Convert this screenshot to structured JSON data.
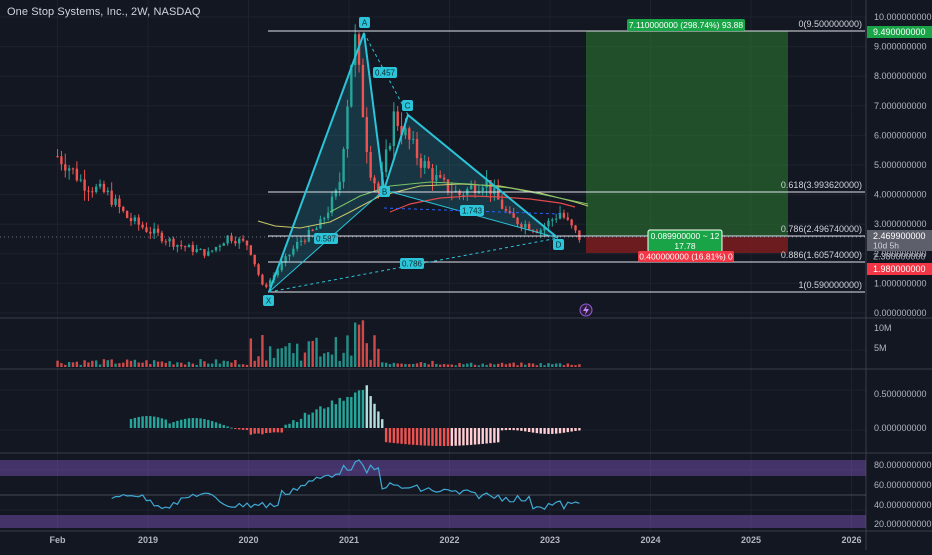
{
  "header": {
    "title": "One Stop Systems, Inc., 2W, NASDAQ"
  },
  "price_axis": {
    "ticks": [
      "10.000000000",
      "9.000000000",
      "8.000000000",
      "7.000000000",
      "6.000000000",
      "5.000000000",
      "4.000000000",
      "3.000000000",
      "2.000000000",
      "1.000000000",
      "0.000000000"
    ],
    "tag_target": "9.490000000",
    "tag_last": "2.469900000",
    "tag_countdown": "10d 5h",
    "tag_2380": "2.380000000",
    "tag_stop": "1.980000000"
  },
  "volume_axis": {
    "ticks": [
      "10M",
      "5M"
    ]
  },
  "macd_axis": {
    "ticks": [
      "0.500000000",
      "0.000000000"
    ]
  },
  "rsi_axis": {
    "ticks": [
      "80.000000000",
      "60.000000000",
      "40.000000000",
      "20.000000000"
    ]
  },
  "time_axis": {
    "labels": [
      "Feb",
      "2019",
      "2020",
      "2021",
      "2022",
      "2023",
      "2024",
      "2025",
      "2026"
    ]
  },
  "fib_levels": [
    {
      "label": "0(9.500000000)"
    },
    {
      "label": "0.618(3.993620000)"
    },
    {
      "label": "0.786(2.496740000)"
    },
    {
      "label": "0.886(1.605740000)"
    },
    {
      "label": "1(0.590000000)"
    }
  ],
  "pattern": {
    "points": [
      "X",
      "A",
      "B",
      "C",
      "D"
    ],
    "ratios": [
      "0.457",
      "1.743",
      "0.587",
      "0.786"
    ]
  },
  "position": {
    "target_label": "7.110000000 (298.74%) 93.88",
    "mid_line1": "0.089900000 ~ 12",
    "mid_line2": "17.78",
    "stop_label": "0.400000000 (16.81%) 0"
  },
  "colors": {
    "background": "#131722",
    "up": "#26a69a",
    "down": "#ef5350",
    "pattern": "#2bc4d8",
    "profit_zone": "#2e7d32",
    "loss_zone": "#8b1e1e",
    "target_tag": "#19a447",
    "stop_tag": "#f23645",
    "rsi": "#3fa9d6",
    "rsi_band": "#7e57c2"
  },
  "icons": {
    "alert": "lightning-bolt-icon"
  },
  "chart_data": {
    "type": "candlestick",
    "title": "One Stop Systems, Inc., 2W, NASDAQ",
    "y_range": [
      0,
      10
    ],
    "x_range": [
      "2018-02",
      "2026"
    ],
    "approx_closes": [
      [
        2018.1,
        5.3
      ],
      [
        2018.2,
        5.0
      ],
      [
        2018.35,
        4.4
      ],
      [
        2018.6,
        4.0
      ],
      [
        2018.8,
        3.2
      ],
      [
        2019.0,
        2.8
      ],
      [
        2019.3,
        2.3
      ],
      [
        2019.6,
        2.0
      ],
      [
        2019.8,
        2.6
      ],
      [
        2020.0,
        2.3
      ],
      [
        2020.15,
        0.8
      ],
      [
        2020.3,
        1.5
      ],
      [
        2020.5,
        2.4
      ],
      [
        2020.7,
        2.9
      ],
      [
        2020.9,
        4.2
      ],
      [
        2021.05,
        9.5
      ],
      [
        2021.2,
        5.0
      ],
      [
        2021.3,
        4.0
      ],
      [
        2021.45,
        6.7
      ],
      [
        2021.7,
        5.2
      ],
      [
        2021.9,
        4.4
      ],
      [
        2022.1,
        4.0
      ],
      [
        2022.35,
        4.5
      ],
      [
        2022.6,
        3.2
      ],
      [
        2022.9,
        2.8
      ],
      [
        2023.1,
        3.4
      ],
      [
        2023.3,
        2.5
      ]
    ],
    "volume_ticks": [
      "10M",
      "5M"
    ],
    "macd_ticks": [
      "0.5",
      "0.0"
    ],
    "rsi_ticks": [
      80,
      60,
      40,
      20
    ]
  }
}
